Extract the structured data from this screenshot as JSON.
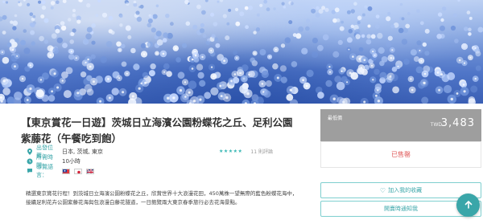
{
  "tour": {
    "title": "【東京賞花一日遊】茨城日立海濱公園粉蝶花之丘、足利公園紫藤花（午餐吃到飽）",
    "info": [
      {
        "icon": "location-pin-icon",
        "label": "出發位置：",
        "value": "日本, 茨城, 東京"
      },
      {
        "icon": "clock-icon",
        "label": "所需時間：",
        "value": "10小時"
      },
      {
        "icon": "chat-icon",
        "label": "導覽語言：",
        "value": ""
      }
    ],
    "languages": [
      "zh-TW",
      "ja",
      "en-GB"
    ],
    "rating": {
      "stars": "★★★★★",
      "reviews": "11 則評論"
    },
    "description": "精選東京賞花行程！到茨城日立海濱公園粉蝶花之丘，欣賞世界十大浪漫花田，450萬株一望無際的藍色粉蝶花海中，接續足利花卉公園紫藤花海與包浪漫白藤花隧道，一日飽覽兩大東京春季旅行必去花海景點。"
  },
  "booking": {
    "price_label": "最低價",
    "currency": "TWD",
    "price": "3,483",
    "status": "已售罄",
    "favorite_label": "加入我的收藏",
    "notify_label": "開賣時通知我"
  },
  "colors": {
    "accent": "#3aa6a9",
    "soldout": "#e05a5a",
    "price_bg": "#9e9e9e"
  }
}
